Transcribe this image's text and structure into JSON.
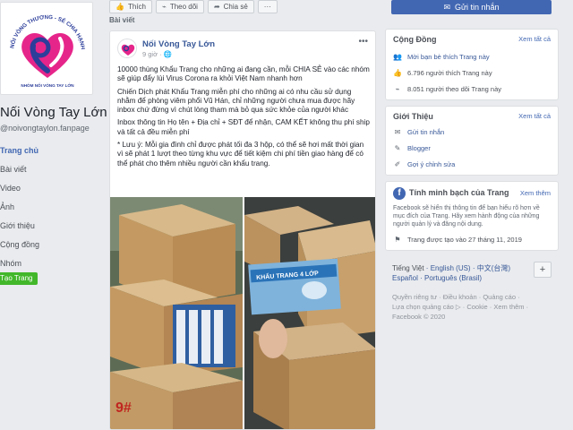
{
  "page": {
    "name": "Nối Vòng Tay Lớn",
    "handle": "@noivongtaylon.fanpage",
    "logo_arc_text": "NỐI VÒNG THƯƠNG - SẺ CHIA HẠNH PHÚC",
    "logo_bottom_text": "NHÓM NỐI VÒNG TAY LỚN"
  },
  "nav": [
    "Trang chủ",
    "Bài viết",
    "Video",
    "Ảnh",
    "Giới thiệu",
    "Cộng đồng",
    "Nhóm"
  ],
  "create_page": "Tạo Trang",
  "actions": {
    "like": "Thích",
    "follow": "Theo dõi",
    "share": "Chia sẻ",
    "more": "···"
  },
  "section_label": "Bài viết",
  "post": {
    "author": "Nối Vòng Tay Lớn",
    "time": "9 giờ · ",
    "paragraphs": [
      "10000 thùng Khẩu Trang cho những ai đang cần, mỗi CHIA SẺ vào các nhóm sẽ giúp đẩy lùi Virus Corona ra khỏi Việt Nam nhanh hơn",
      "Chiến Dịch phát Khẩu Trang miễn phí cho những ai có nhu cầu sử dụng nhằm để phòng viêm phổi Vũ Hán, chỉ những người chưa mua được hãy inbox chứ đừng vì chút lòng tham mà bỏ qua sức khỏe của người khác",
      "Inbox thông tin Họ tên + Địa chỉ + SĐT để nhận, CAM KẾT không thu phí ship và tất cả đều miễn phí",
      "* Lưu ý: Mỗi gia đình chỉ được phát tối đa 3 hộp, có thể sẽ hơi mất thời gian vì sẽ phát 1 lượt theo từng khu vực để tiết kiệm chi phí tiền giao hàng để có thể phát cho thêm nhiều người cần khẩu trang."
    ],
    "image_box_text": "KHẨU TRANG 4 LỚP",
    "image_box_number": "9#"
  },
  "messenger_button": "Gửi tin nhắn",
  "community": {
    "title": "Cộng Đồng",
    "see_all": "Xem tất cả",
    "rows": [
      {
        "icon": "invite-friends-icon",
        "text": "Mời bạn bè thích Trang này"
      },
      {
        "icon": "like-icon",
        "text": "6.796 người thích Trang này"
      },
      {
        "icon": "follow-icon",
        "text": "8.051 người theo dõi Trang này"
      }
    ]
  },
  "about": {
    "title": "Giới Thiệu",
    "see_all": "Xem tất cả",
    "rows": [
      {
        "icon": "messenger-icon",
        "text": "Gửi tin nhắn"
      },
      {
        "icon": "blogger-icon",
        "text": "Blogger"
      },
      {
        "icon": "edit-icon",
        "text": "Gợi ý chỉnh sửa"
      }
    ]
  },
  "transparency": {
    "title": "Tính minh bạch của Trang",
    "see_more": "Xem thêm",
    "text": "Facebook sẽ hiển thị thông tin để bạn hiểu rõ hơn về mục đích của Trang. Hãy xem hành động của những người quản lý và đăng nội dung.",
    "created": "Trang được tạo vào 27 tháng 11, 2019"
  },
  "languages": {
    "line1": [
      "Tiếng Việt",
      "English (US)",
      "中文(台灣)"
    ],
    "line2": [
      "Español",
      "Português (Brasil)"
    ],
    "plus": "+"
  },
  "footer": {
    "line1": "Quyền riêng tư · Điều khoản · Quảng cáo ·",
    "line2": "Lựa chọn quảng cáo ▷ · Cookie · Xem thêm ·",
    "line3": "Facebook © 2020"
  }
}
